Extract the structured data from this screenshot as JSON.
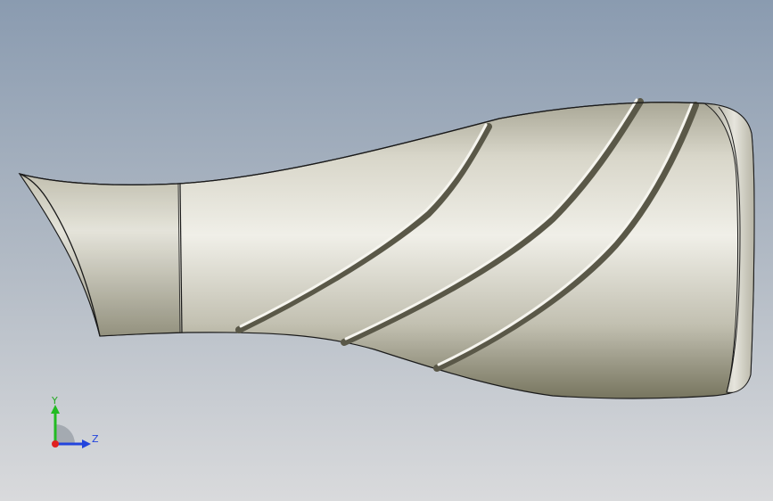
{
  "viewport": {
    "model_name": "",
    "shaded": true
  },
  "triad": {
    "y_label": "Y",
    "z_label": "Z",
    "x_color": "#e02020",
    "y_color": "#22bb22",
    "z_color": "#2244dd"
  },
  "colors": {
    "surface": "#c9c7ba",
    "surface_shadow": "#6f6d60",
    "edge": "#1a1a1a"
  }
}
